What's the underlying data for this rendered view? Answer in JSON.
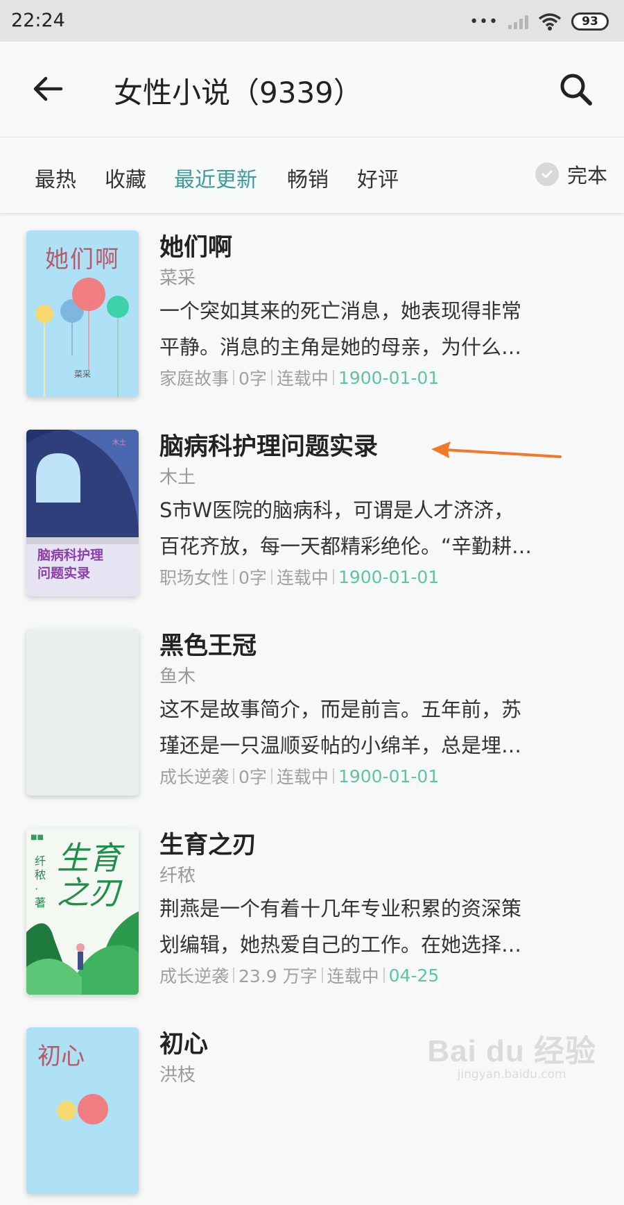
{
  "status": {
    "time": "22:24",
    "battery": "93"
  },
  "header": {
    "title": "女性小说（9339）"
  },
  "tabs": [
    {
      "label": "最热"
    },
    {
      "label": "收藏"
    },
    {
      "label": "最近更新"
    },
    {
      "label": "畅销"
    },
    {
      "label": "好评"
    }
  ],
  "filter": {
    "label": "完本"
  },
  "books": [
    {
      "title": "她们啊",
      "author": "菜采",
      "desc1": "一个突如其来的死亡消息，她表现得非常",
      "desc2": "平静。消息的主角是她的母亲，为什么…",
      "genre": "家庭故事",
      "words": "0字",
      "status": "连载中",
      "date": "1900-01-01",
      "cover_title": "她们啊",
      "cover_author": "菜采"
    },
    {
      "title": "脑病科护理问题实录",
      "author": "木土",
      "desc1": "S市W医院的脑病科，可谓是人才济济，",
      "desc2": "百花齐放，每一天都精彩绝伦。“辛勤耕…",
      "genre": "职场女性",
      "words": "0字",
      "status": "连载中",
      "date": "1900-01-01",
      "cover_title_1": "脑病科护理",
      "cover_title_2": "问题实录",
      "cover_author": "木土"
    },
    {
      "title": "黑色王冠",
      "author": "鱼木",
      "desc1": "这不是故事简介，而是前言。五年前，苏",
      "desc2": "瑾还是一只温顺妥帖的小绵羊，总是埋…",
      "genre": "成长逆袭",
      "words": "0字",
      "status": "连载中",
      "date": "1900-01-01"
    },
    {
      "title": "生育之刃",
      "author": "纤秾",
      "desc1": "荆燕是一个有着十几年专业积累的资深策",
      "desc2": "划编辑，她热爱自己的工作。在她选择…",
      "genre": "成长逆袭",
      "words": "23.9 万字",
      "status": "连载中",
      "date": "04-25",
      "cover_title_1": "生育",
      "cover_title_2": "之刃",
      "cover_author": "纤秾·著"
    },
    {
      "title": "初心",
      "author": "洪枝",
      "cover_title": "初心"
    }
  ],
  "watermark": {
    "logo": "Bai du 经验",
    "url": "jingyan.baidu.com"
  },
  "colors": {
    "accent": "#3d9a9e",
    "date": "#5ec4a7",
    "arrow": "#f07a2a"
  }
}
